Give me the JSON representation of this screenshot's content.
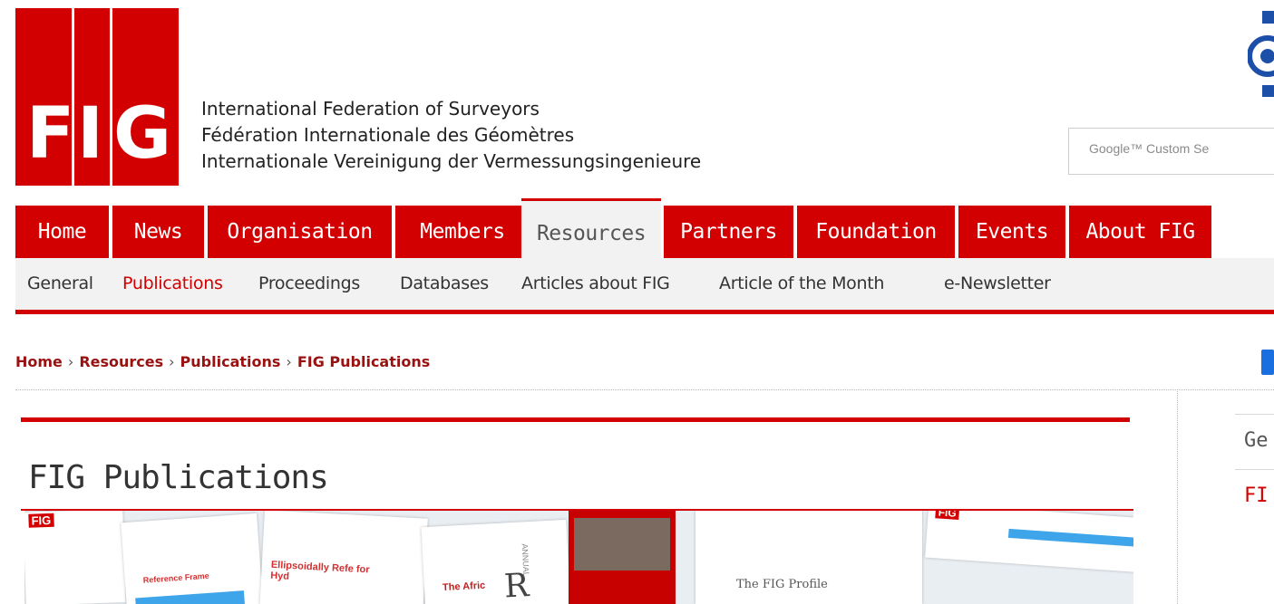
{
  "logo": {
    "letters": [
      "F",
      "I",
      "G"
    ]
  },
  "org_names": [
    "International Federation of Surveyors",
    "Fédération Internationale des Géomètres",
    "Internationale Vereinigung der Vermessungsingenieure"
  ],
  "search": {
    "placeholder": "Google™ Custom Se"
  },
  "main_nav": [
    {
      "label": "Home",
      "active": false
    },
    {
      "label": "News",
      "active": false
    },
    {
      "label": "Organisation",
      "active": false
    },
    {
      "label": "Members",
      "active": false
    },
    {
      "label": "Resources",
      "active": true
    },
    {
      "label": "Partners",
      "active": false
    },
    {
      "label": "Foundation",
      "active": false
    },
    {
      "label": "Events",
      "active": false
    },
    {
      "label": "About FIG",
      "active": false
    }
  ],
  "sub_nav": [
    {
      "label": "General",
      "active": false
    },
    {
      "label": "Publications",
      "active": true
    },
    {
      "label": "Proceedings",
      "active": false
    },
    {
      "label": "Databases",
      "active": false
    },
    {
      "label": "Articles about FIG",
      "active": false
    },
    {
      "label": "Article of the Month",
      "active": false
    },
    {
      "label": "e-Newsletter",
      "active": false
    }
  ],
  "breadcrumb": [
    "Home",
    "Resources",
    "Publications",
    "FIG Publications"
  ],
  "breadcrumb_separator": "›",
  "page_title": "FIG Publications",
  "collage_texts": {
    "ellipsoidal": "Ellipsoidally Refe for Hyd",
    "reference": "Reference Frame",
    "africa": "The Afric",
    "annual": "ANNUAL",
    "big_letter": "R",
    "profile": "The FIG Profile",
    "fig_badge": "FIG"
  },
  "side_menu": [
    {
      "label": "Ge"
    },
    {
      "label": "FI"
    }
  ],
  "colors": {
    "brand_red": "#d20000",
    "breadcrumb_red": "#9a1111",
    "nav_grey": "#f2f2f2",
    "accent_blue": "#1a6fe0"
  }
}
